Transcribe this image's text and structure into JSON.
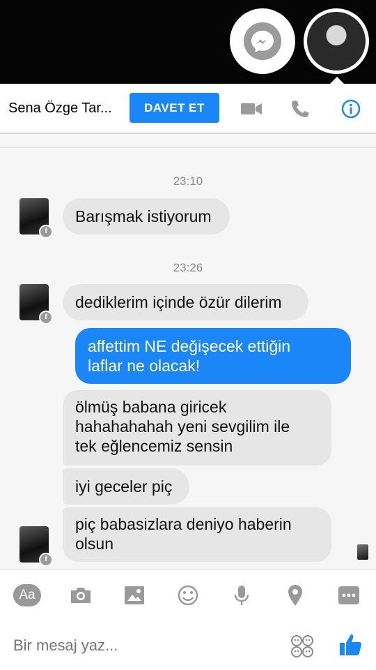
{
  "header": {
    "contact_name": "Sena Özge Tar...",
    "invite_label": "DAVET ET"
  },
  "colors": {
    "accent": "#1b86f7",
    "incoming_bubble": "#e6e6e6",
    "chat_bg": "#f6f6f6"
  },
  "icons": [
    "messenger-icon",
    "video-call-icon",
    "phone-icon",
    "info-icon",
    "camera-icon",
    "image-icon",
    "emoji-icon",
    "microphone-icon",
    "location-icon",
    "more-icon",
    "sticker-icon",
    "like-icon"
  ],
  "chat": {
    "timestamps": [
      "23:10",
      "23:26"
    ],
    "messages": [
      {
        "dir": "in",
        "text": "Barışmak istiyorum"
      },
      {
        "dir": "in",
        "text": "dediklerim içinde özür dilerim"
      },
      {
        "dir": "out",
        "line1": "affettim NE değişecek ettiğin",
        "line2": "laflar ne olacak!"
      },
      {
        "dir": "in",
        "line1": "ölmüş babana giricek",
        "line2": "hahahahahah yeni sevgilim ile",
        "line3": "tek eğlencemiz sensin"
      },
      {
        "dir": "in",
        "text": "iyi geceler piç"
      },
      {
        "dir": "in",
        "line1": "piç babasizlara deniyo  haberin",
        "line2": "olsun"
      }
    ]
  },
  "composer": {
    "aa_label": "Aa",
    "placeholder": "Bir mesaj yaz..."
  }
}
